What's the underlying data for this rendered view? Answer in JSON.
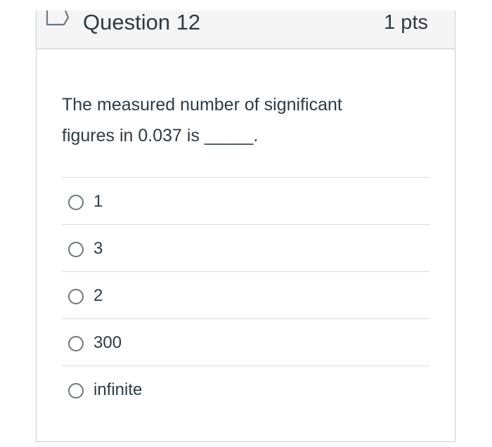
{
  "question": {
    "title": "Question 12",
    "points": "1 pts",
    "flag_icon": "flag-bookmark-icon",
    "prompt": "The measured number of significant figures in 0.037 is _____."
  },
  "answers": [
    {
      "label": "1",
      "selected": false
    },
    {
      "label": "3",
      "selected": false
    },
    {
      "label": "2",
      "selected": false
    },
    {
      "label": "300",
      "selected": false
    },
    {
      "label": "infinite",
      "selected": false
    }
  ]
}
